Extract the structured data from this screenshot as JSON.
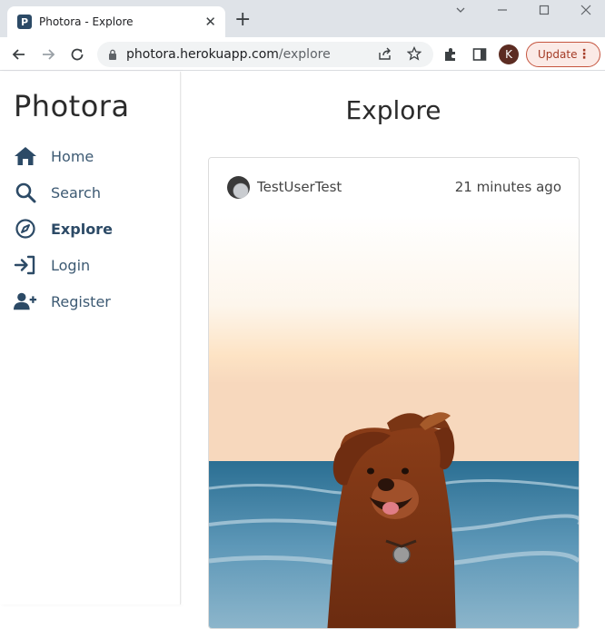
{
  "browser": {
    "tab_title": "Photora - Explore",
    "favicon_letter": "P",
    "url_domain": "photora.herokuapp.com",
    "url_path": "/explore",
    "profile_initial": "K",
    "update_label": "Update"
  },
  "sidebar": {
    "brand": "Photora",
    "items": [
      {
        "label": "Home",
        "icon": "home-icon",
        "active": false
      },
      {
        "label": "Search",
        "icon": "search-icon",
        "active": false
      },
      {
        "label": "Explore",
        "icon": "compass-icon",
        "active": true
      },
      {
        "label": "Login",
        "icon": "login-icon",
        "active": false
      },
      {
        "label": "Register",
        "icon": "user-plus-icon",
        "active": false
      }
    ]
  },
  "main": {
    "title": "Explore",
    "post": {
      "username": "TestUserTest",
      "time": "21 minutes ago",
      "image": "dog-at-beach-photo"
    }
  },
  "colors": {
    "nav_icon": "#2c4a66",
    "update_accent": "#c5553f"
  }
}
